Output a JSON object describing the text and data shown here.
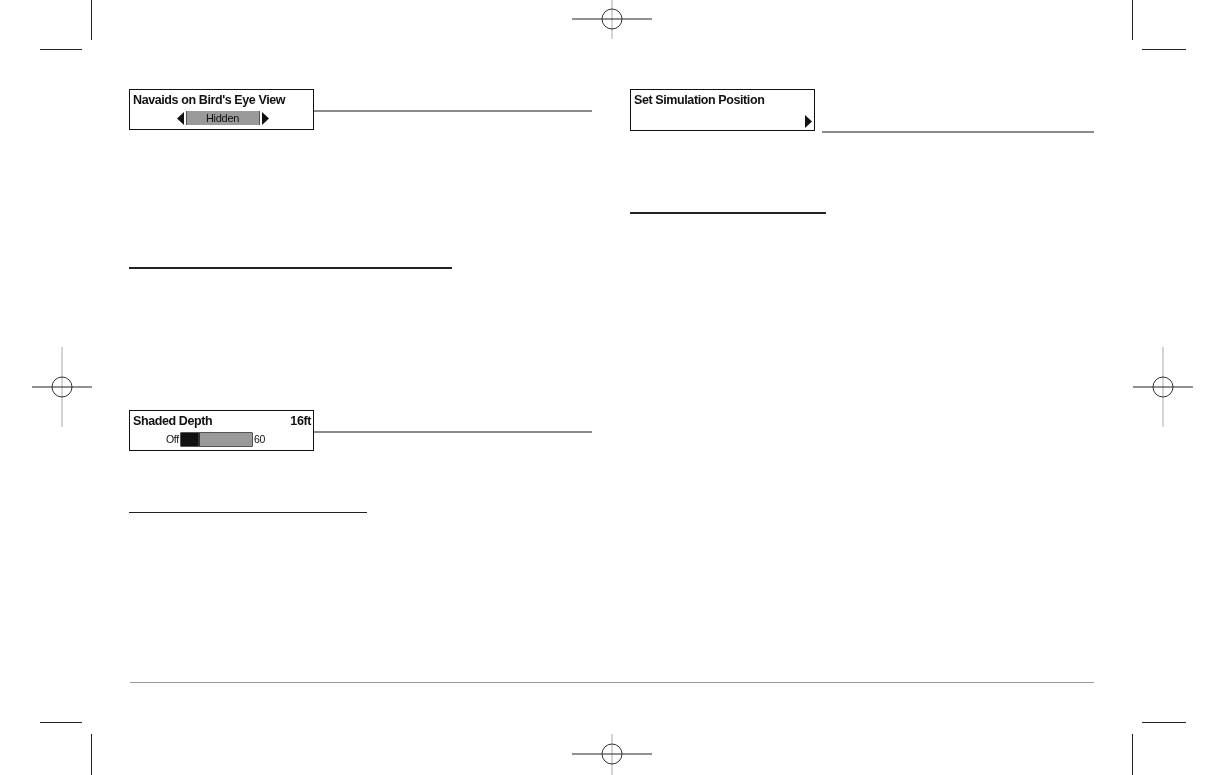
{
  "left_page": {
    "menu_boxes": [
      {
        "kind": "option",
        "title": "Navaids on Bird's Eye View",
        "value": "Hidden"
      },
      {
        "kind": "slider",
        "title": "Shaded Depth",
        "reading": "16ft",
        "min_label": "Off",
        "max_label": "60",
        "level": 0.27
      }
    ]
  },
  "right_page": {
    "menu_boxes": [
      {
        "kind": "submenu",
        "title": "Set Simulation Position"
      }
    ]
  }
}
